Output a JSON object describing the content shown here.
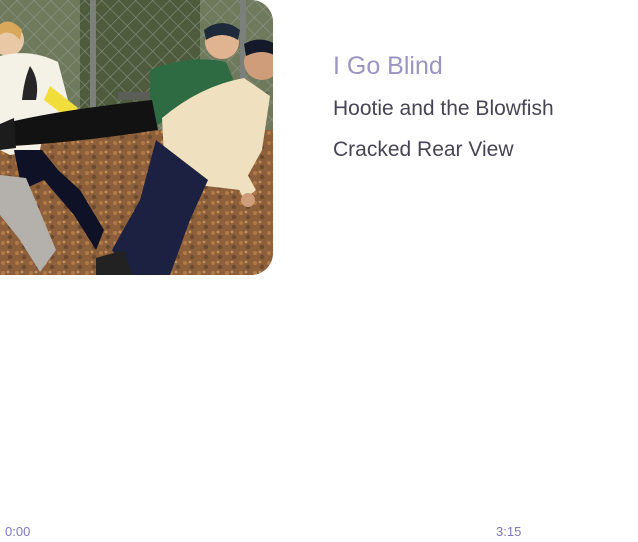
{
  "now_playing": {
    "title": "I Go Blind",
    "artist": "Hootie and the Blowfish",
    "album": "Cracked Rear View"
  },
  "playback": {
    "elapsed": "0:00",
    "duration": "3:15",
    "progress": 0
  },
  "colors": {
    "title": "#9a95c2",
    "secondary_text": "#474555",
    "time_text": "#7d77c8",
    "background": "#ffffff"
  }
}
